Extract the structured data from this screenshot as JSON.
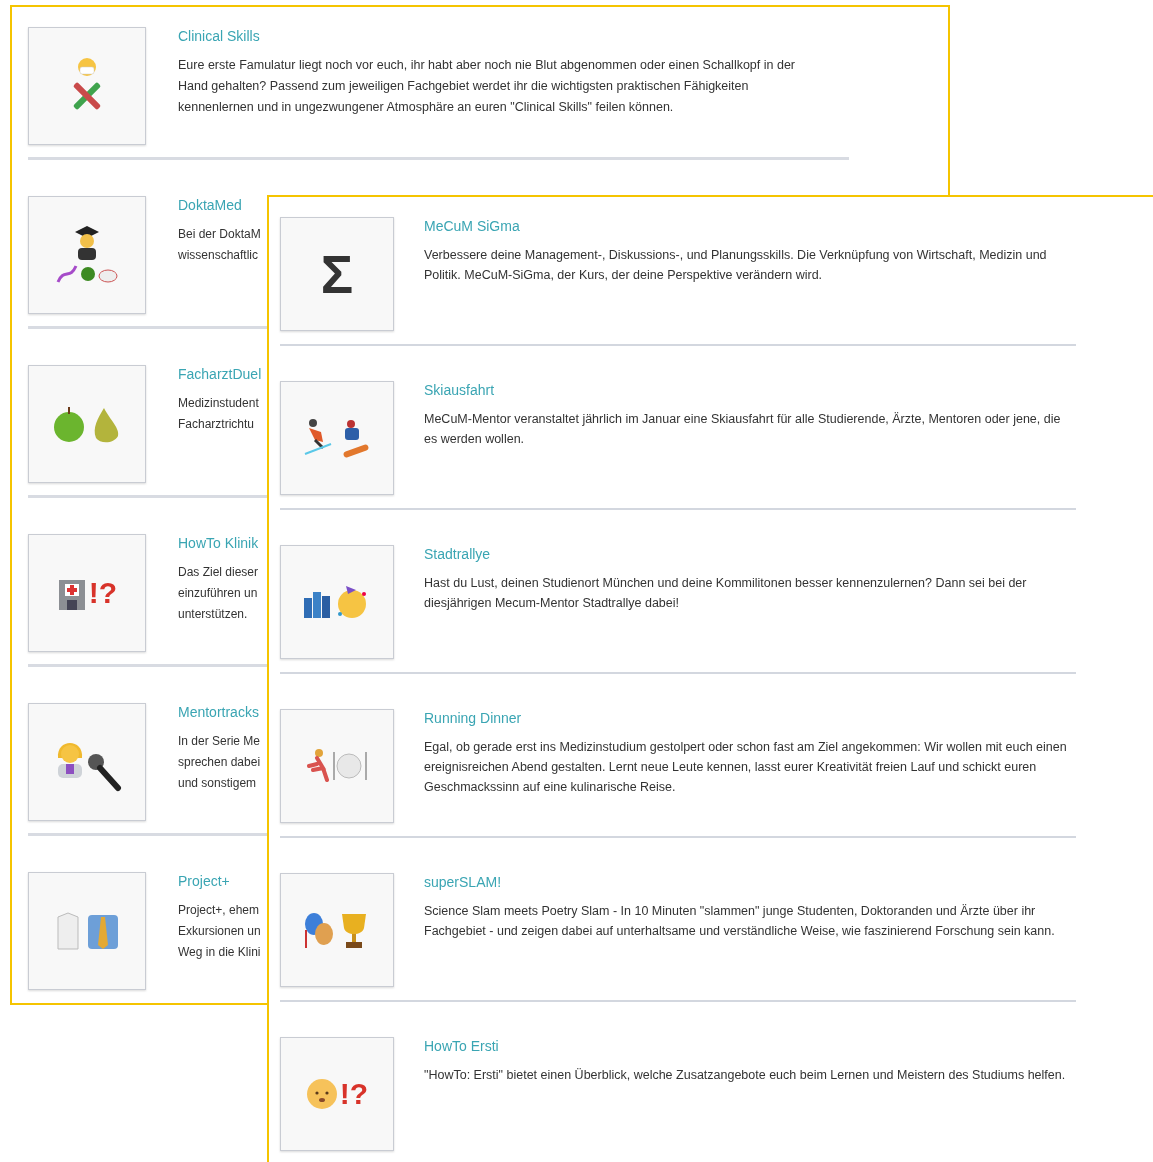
{
  "left_page": {
    "items": [
      {
        "title": "Clinical Skills",
        "text": "Eure erste Famulatur liegt noch vor euch, ihr habt aber noch nie Blut abgenommen oder einen Schallkopf in der Hand gehalten? Passend zum jeweiligen Fachgebiet werdet ihr die wichtigsten praktischen Fähigkeiten kennenlernen und in ungezwungener Atmosphäre an euren \"Clinical Skills\" feilen können."
      },
      {
        "title": "DoktaMed",
        "visible_lines": [
          "Bei der DoktaM",
          "wissenschaftlic"
        ]
      },
      {
        "title": "FacharztDuel",
        "visible_lines": [
          "Medizinstudent",
          "Facharztrichtu"
        ]
      },
      {
        "title": "HowTo Klinik",
        "symbol": "!?",
        "visible_lines": [
          "Das Ziel dieser",
          "einzuführen un",
          "unterstützen."
        ]
      },
      {
        "title": "Mentortracks",
        "visible_lines": [
          "In der Serie Me",
          "sprechen dabei",
          "und sonstigem"
        ]
      },
      {
        "title": "Project+",
        "visible_lines": [
          "Project+, ehem",
          "Exkursionen un",
          "Weg in die Klini"
        ]
      }
    ]
  },
  "right_page": {
    "items": [
      {
        "title": "MeCuM SiGma",
        "symbol": "Σ",
        "text": "Verbessere deine Management-, Diskussions-, und Planungsskills. Die Verknüpfung von Wirtschaft, Medizin und Politik. MeCuM-SiGma, der Kurs, der deine Perspektive verändern wird."
      },
      {
        "title": "Skiausfahrt",
        "text": "MeCuM-Mentor veranstaltet jährlich im Januar eine Skiausfahrt für alle Studierende, Ärzte, Mentoren oder jene, die es werden wollen."
      },
      {
        "title": "Stadtrallye",
        "text": "Hast du Lust, deinen Studienort München und deine Kommilitonen besser kennenzulernen? Dann sei bei der diesjährigen Mecum-Mentor Stadtrallye dabei!"
      },
      {
        "title": "Running Dinner",
        "text": "Egal, ob gerade erst ins Medizinstudium gestolpert oder schon fast am Ziel angekommen: Wir wollen mit euch einen ereignisreichen Abend gestalten. Lernt neue Leute kennen, lasst eurer Kreativität freien Lauf und schickt euren Geschmackssinn auf eine kulinarische Reise."
      },
      {
        "title": "superSLAM!",
        "text": "Science Slam meets Poetry Slam - In 10 Minuten \"slammen\" junge Studenten, Doktoranden und Ärzte über ihr Fachgebiet -  und zeigen dabei auf unterhaltsame und verständliche Weise, wie faszinierend Forschung sein kann."
      },
      {
        "title": "HowTo Ersti",
        "symbol": "!?",
        "text": "\"HowTo: Ersti\" bietet einen Überblick, welche Zusatzangebote euch beim Lernen und Meistern des Studiums helfen."
      }
    ]
  }
}
